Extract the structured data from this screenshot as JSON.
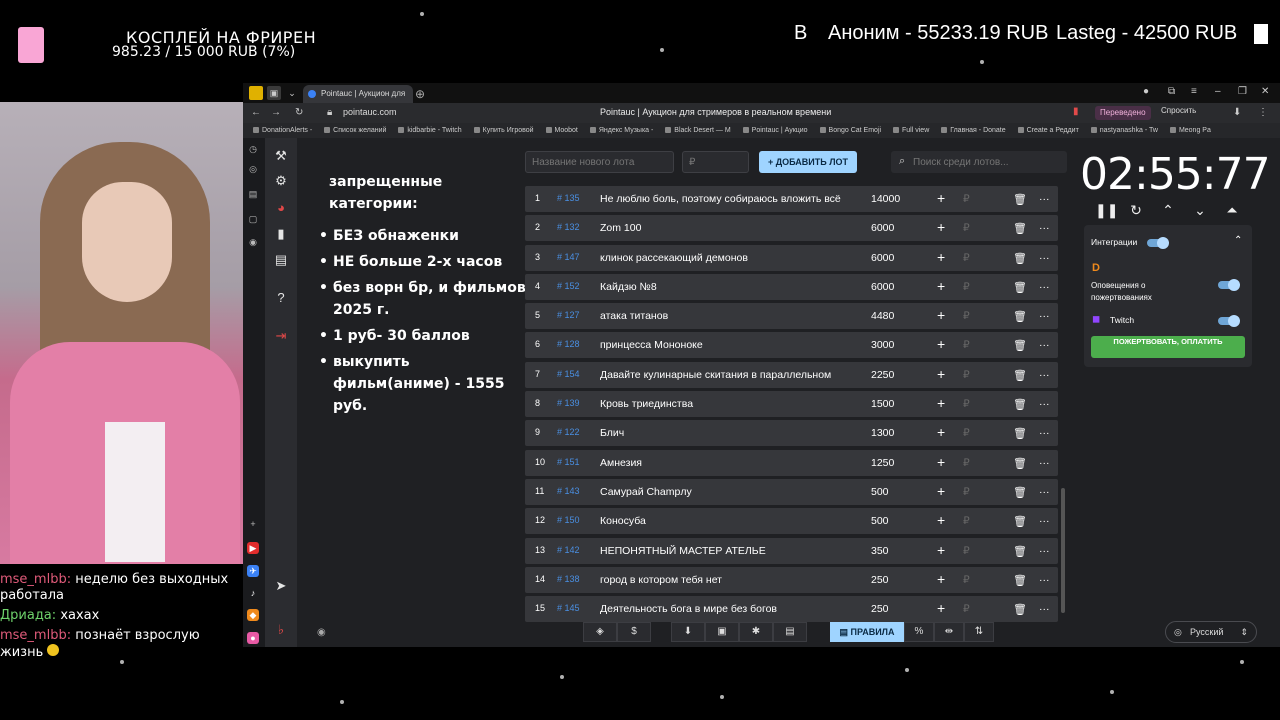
{
  "overlay": {
    "goal_title": "КОСПЛЕЙ НА ФРИРЕН",
    "goal_progress": "985.23 / 15 000 RUB (7%)",
    "donor_letter": "B",
    "donor1": "Аноним - 55233.19 RUB",
    "donor2": "Lasteg - 42500 RUB"
  },
  "chat": [
    {
      "user": "mse_mlbb:",
      "text": "неделю без выходных работала"
    },
    {
      "user": "Дриада:",
      "text": "хахах"
    },
    {
      "user": "mse_mlbb:",
      "text": "познаёт взрослую жизнь"
    }
  ],
  "browser": {
    "tab_title": "Pointauc | Аукцион для",
    "url": "pointauc.com",
    "page_title": "Pointauc | Аукцион для стримеров в реальном времени",
    "translated_label": "Переведено",
    "ask_label": "Спросить",
    "bookmarks": [
      "DonationAlerts -",
      "Список желаний",
      "kidbarbie - Twitch",
      "Купить Игровой",
      "Moobot",
      "Яндекс Музыка -",
      "Black Desert — М",
      "Pointauc | Аукцио",
      "Bongo Cat Emoji",
      "Full view",
      "Главная - Donate",
      "Create a Реддит",
      "nastyanashka - Tw",
      "Meong Pa"
    ]
  },
  "rules": {
    "title": "запрещенные категории:",
    "items": [
      "БЕЗ обнаженки",
      "НЕ больше 2-х часов",
      "без ворн бр, и фильмов 2025 г.",
      "1 руб- 30 баллов",
      "выкупить фильм(аниме) - 1555 руб."
    ]
  },
  "controls": {
    "lot_placeholder": "Название нового лота",
    "amount_placeholder": "₽",
    "add_lot_label": "ДОБАВИТЬ ЛОТ",
    "search_placeholder": "Поиск среди лотов..."
  },
  "timer": "02:55:77",
  "integrations": {
    "title": "Интеграции",
    "donation_label": "Оповещения о пожертвованиях",
    "twitch_label": "Twitch",
    "donate_button": "ПОЖЕРТВОВАТЬ, ОПЛАТИТЬ"
  },
  "lots": [
    {
      "idx": "1",
      "id": "# 135",
      "name": "Не люблю боль, поэтому собираюсь вложить всё",
      "amount": "14000"
    },
    {
      "idx": "2",
      "id": "# 132",
      "name": "Zom 100",
      "amount": "6000"
    },
    {
      "idx": "3",
      "id": "# 147",
      "name": "клинок рассекающий демонов",
      "amount": "6000"
    },
    {
      "idx": "4",
      "id": "# 152",
      "name": "Кайдзю №8",
      "amount": "6000"
    },
    {
      "idx": "5",
      "id": "# 127",
      "name": "атака титанов",
      "amount": "4480"
    },
    {
      "idx": "6",
      "id": "# 128",
      "name": "принцесса Мононоке",
      "amount": "3000"
    },
    {
      "idx": "7",
      "id": "# 154",
      "name": "Давайте кулинарные скитания в параллельном",
      "amount": "2250"
    },
    {
      "idx": "8",
      "id": "# 139",
      "name": "Кровь триединства",
      "amount": "1500"
    },
    {
      "idx": "9",
      "id": "# 122",
      "name": "Блич",
      "amount": "1300"
    },
    {
      "idx": "10",
      "id": "# 151",
      "name": "Амнезия",
      "amount": "1250"
    },
    {
      "idx": "11",
      "id": "# 143",
      "name": "Самурай Champлу",
      "amount": "500"
    },
    {
      "idx": "12",
      "id": "# 150",
      "name": "Коносуба",
      "amount": "500"
    },
    {
      "idx": "13",
      "id": "# 142",
      "name": "НЕПОНЯТНЫЙ МАСТЕР АТЕЛЬЕ",
      "amount": "350"
    },
    {
      "idx": "14",
      "id": "# 138",
      "name": "город в котором тебя нет",
      "amount": "250"
    },
    {
      "idx": "15",
      "id": "# 145",
      "name": "Деятельность бога в мире без богов",
      "amount": "250"
    }
  ],
  "bottom": {
    "rules_label": "ПРАВИЛА",
    "language": "Русский"
  },
  "colors": {
    "accent": "#9fd4ff",
    "row_bg": "#36373b",
    "lot_id": "#4a8fe2",
    "donate": "#4cae4c"
  }
}
